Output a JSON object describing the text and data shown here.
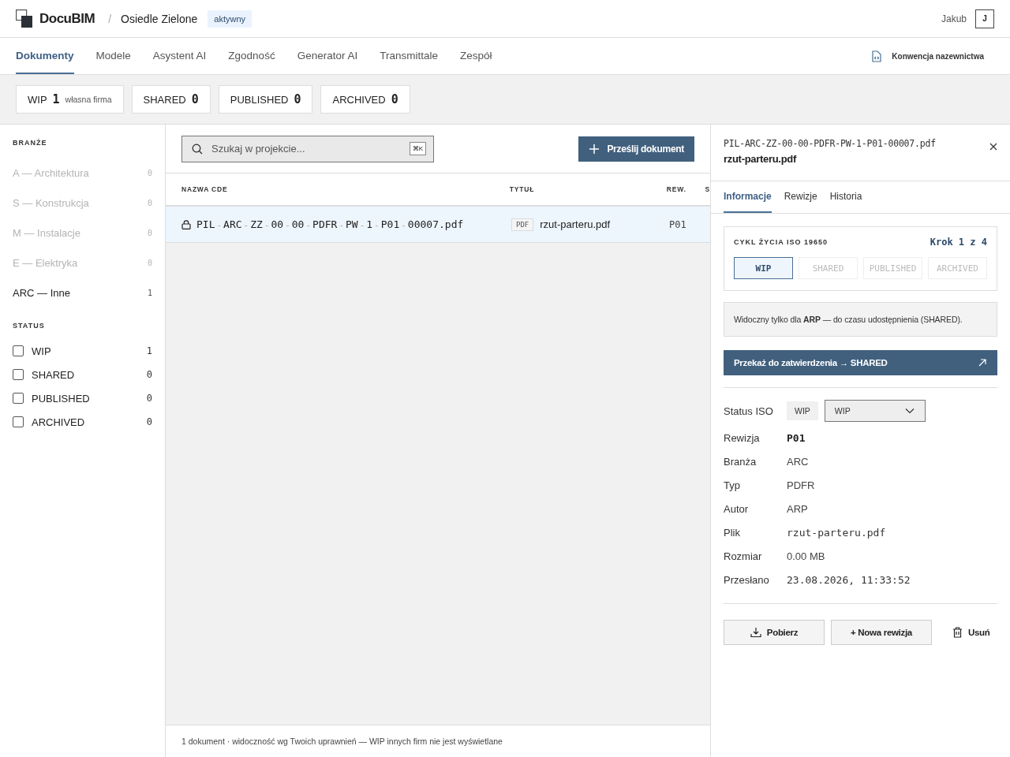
{
  "header": {
    "logo": "DocuBIM",
    "separator": "/",
    "project": "Osiedle Zielone",
    "project_status": "aktywny",
    "user": "Jakub",
    "avatar": "J"
  },
  "nav": {
    "tabs": [
      {
        "label": "Dokumenty",
        "selected": true
      },
      {
        "label": "Modele",
        "selected": false
      },
      {
        "label": "Asystent AI",
        "selected": false
      },
      {
        "label": "Zgodność",
        "selected": false
      },
      {
        "label": "Generator AI",
        "selected": false
      },
      {
        "label": "Transmittale",
        "selected": false
      },
      {
        "label": "Zespół",
        "selected": false
      }
    ],
    "link": "Konwencja nazewnictwa"
  },
  "status_tiles": [
    {
      "label": "WIP",
      "count": "1",
      "note": "własna firma"
    },
    {
      "label": "SHARED",
      "count": "0"
    },
    {
      "label": "PUBLISHED",
      "count": "0"
    },
    {
      "label": "ARCHIVED",
      "count": "0"
    }
  ],
  "sidebar": {
    "branches_title": "BRANŻE",
    "branches": [
      {
        "label": "A — Architektura",
        "count": "0",
        "disabled": true
      },
      {
        "label": "S — Konstrukcja",
        "count": "0",
        "disabled": true
      },
      {
        "label": "M — Instalacje",
        "count": "0",
        "disabled": true
      },
      {
        "label": "E — Elektryka",
        "count": "0",
        "disabled": true
      },
      {
        "label": "ARC — Inne",
        "count": "1",
        "disabled": false
      }
    ],
    "status_title": "STATUS",
    "statuses": [
      {
        "label": "WIP",
        "count": "1",
        "checked": false
      },
      {
        "label": "SHARED",
        "count": "0",
        "checked": false
      },
      {
        "label": "PUBLISHED",
        "count": "0",
        "checked": false
      },
      {
        "label": "ARCHIVED",
        "count": "0",
        "checked": false
      }
    ]
  },
  "documents": {
    "search": {
      "placeholder": "Szukaj w projekcie...",
      "shortcut": "⌘K"
    },
    "upload_button": "Prześlij dokument",
    "columns": [
      "NAZWA CDE",
      "TYTUŁ",
      "REW.",
      "S"
    ],
    "rows": [
      {
        "locked": true,
        "name_parts": [
          "PIL",
          "ARC",
          "ZZ",
          "00",
          "00",
          "PDFR",
          "PW",
          "1",
          "P01",
          "00007.pdf"
        ],
        "separator": "-",
        "format": "PDF",
        "title": "rzut-parteru.pdf",
        "revision": "P01",
        "selected": true
      }
    ],
    "footer": "1 dokument · widoczność wg Twoich uprawnień — WIP innych firm nie jest wyświetlane"
  },
  "detail": {
    "file_code": "PIL-ARC-ZZ-00-00-PDFR-PW-1-P01-00007.pdf",
    "title": "rzut-parteru.pdf",
    "tabs": [
      {
        "label": "Informacje",
        "selected": true
      },
      {
        "label": "Rewizje",
        "selected": false
      },
      {
        "label": "Historia",
        "selected": false
      }
    ],
    "lifecycle": {
      "title": "CYKL ŻYCIA ISO 19650",
      "step": "Krok 1 z 4",
      "steps": [
        {
          "label": "WIP",
          "selected": true
        },
        {
          "label": "SHARED",
          "selected": false
        },
        {
          "label": "PUBLISHED",
          "selected": false
        },
        {
          "label": "ARCHIVED",
          "selected": false
        }
      ]
    },
    "notice": "Widoczny tylko dla **ARP** — do czasu udostępnienia (SHARED).",
    "action": "Przekaż do zatwierdzenia → SHARED",
    "fields": [
      {
        "label": "Status ISO",
        "kind": "status",
        "badge": "WIP",
        "value": "WIP"
      },
      {
        "label": "Rewizja",
        "kind": "code",
        "value": "P01"
      },
      {
        "label": "Branża",
        "kind": "text",
        "value": "ARC"
      },
      {
        "label": "Typ",
        "kind": "text",
        "value": "PDFR"
      },
      {
        "label": "Autor",
        "kind": "text",
        "value": "ARP"
      },
      {
        "label": "Plik",
        "kind": "mono",
        "value": "rzut-parteru.pdf"
      },
      {
        "label": "Rozmiar",
        "kind": "text",
        "value": "0.00 MB"
      },
      {
        "label": "Przesłano",
        "kind": "mono",
        "value": "23.08.2026, 11:33:52"
      }
    ],
    "buttons": [
      {
        "label": "Pobierz",
        "kind": "download"
      },
      {
        "label": "+ Nowa rewizja",
        "kind": "plain"
      },
      {
        "label": "Usuń",
        "kind": "delete"
      }
    ]
  }
}
